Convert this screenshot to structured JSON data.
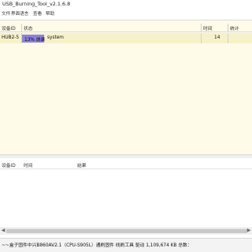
{
  "window": {
    "title": "USB_Burning_Tool_v2.1.6.8"
  },
  "menu": {
    "items": [
      "文件",
      "界面语言",
      "查看",
      "帮助"
    ]
  },
  "upper_table": {
    "headers": {
      "device": "设备ID",
      "status": "状态",
      "time": "时间",
      "stats": "统计"
    },
    "rows": [
      {
        "device": "HUB2-5",
        "progress_percent": 13,
        "progress_label": "13% 烧录",
        "status": "system",
        "time": "14"
      }
    ]
  },
  "lower_table": {
    "headers": {
      "device": "设备ID",
      "time": "时间",
      "result": "结果"
    }
  },
  "statusbar": {
    "text": "~~盒子固件中兴B860AV2.1（CPU-S905L）通刷固件 线刷工具 驱动 1,109,674 KB  总数："
  },
  "colors": {
    "row_highlight": "#fefbe8",
    "progress_fill": "#8b82e0"
  },
  "icons": {
    "scroll_left": "arrow-left-icon",
    "scroll_right": "arrow-right-icon"
  }
}
